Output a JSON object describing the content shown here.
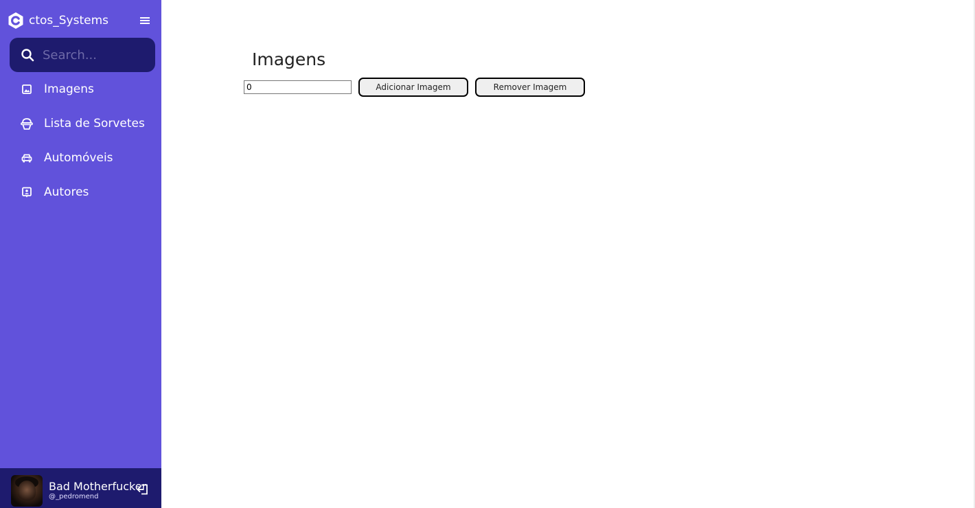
{
  "app": {
    "brand": "ctos_Systems"
  },
  "search": {
    "placeholder": "Search..."
  },
  "sidebar": {
    "items": [
      {
        "label": "Imagens",
        "icon": "image-icon"
      },
      {
        "label": "Lista de Sorvetes",
        "icon": "ice-cream-icon"
      },
      {
        "label": "Automóveis",
        "icon": "car-icon"
      },
      {
        "label": "Autores",
        "icon": "author-badge-icon"
      }
    ]
  },
  "profile": {
    "name": "Bad Motherfucker",
    "handle": "@_pedromend"
  },
  "main": {
    "title": "Imagens",
    "input_value": "0",
    "add_button": "Adicionar Imagem",
    "remove_button": "Remover Imagem"
  },
  "colors": {
    "sidebar_bg": "#6152db",
    "search_bg": "#1e1b6e",
    "profile_bg": "#1e1b6e"
  }
}
